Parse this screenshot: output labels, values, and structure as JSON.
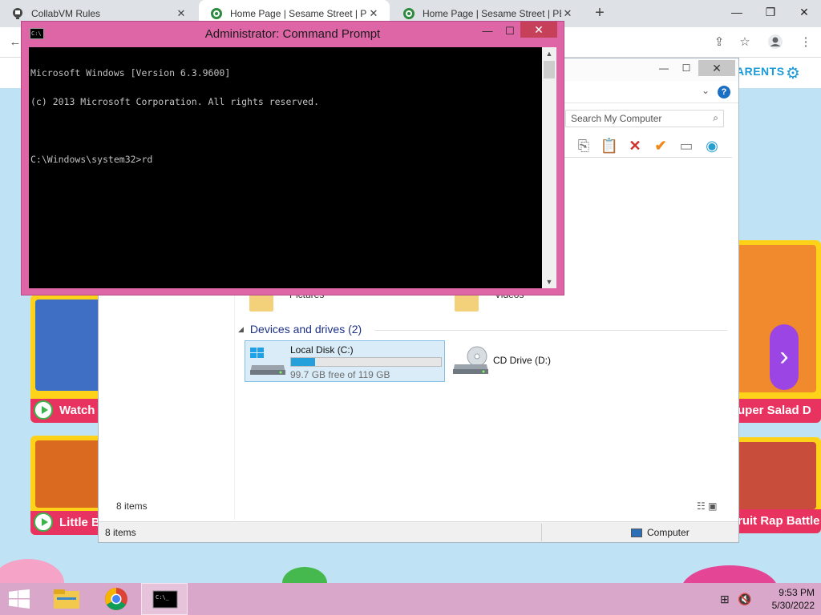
{
  "browser": {
    "tabs": [
      {
        "title": "CollabVM Rules",
        "icon": "collabvm-icon"
      },
      {
        "title": "Home Page | Sesame Street | PBS",
        "icon": "pbs-kids-icon"
      },
      {
        "title": "Home Page | Sesame Street | PBS",
        "icon": "pbs-kids-icon"
      }
    ],
    "window_controls": {
      "minimize": "—",
      "maximize": "❐",
      "close": "✕"
    },
    "new_tab": "+"
  },
  "page": {
    "parents_label": "ARENTS",
    "cards": [
      {
        "cta": "Watch",
        "color": "#e8325f"
      },
      {
        "cta": "Little B",
        "color": "#e8325f"
      },
      {
        "cta": "uper Salad D",
        "color": "#e8325f"
      },
      {
        "cta": "ruit Rap Battle",
        "color": "#e8325f"
      }
    ]
  },
  "explorer": {
    "search_placeholder": "Search My Computer",
    "libraries": [
      {
        "label": "Pictures"
      },
      {
        "label": "Videos"
      }
    ],
    "section_title": "Devices and drives (2)",
    "drives": [
      {
        "name": "Local Disk (C:)",
        "free_text": "99.7 GB free of 119 GB",
        "used_fraction": 0.162
      },
      {
        "name": "CD Drive (D:)"
      }
    ],
    "items_count": "8 items",
    "status": {
      "items": "8 items",
      "location": "Computer"
    }
  },
  "cmd": {
    "title": "Administrator: Command Prompt",
    "lines": [
      "Microsoft Windows [Version 6.3.9600]",
      "(c) 2013 Microsoft Corporation. All rights reserved.",
      "",
      "C:\\Windows\\system32>rd"
    ]
  },
  "taskbar": {
    "time": "9:53 PM",
    "date": "5/30/2022",
    "color": "#d8a7ca"
  }
}
